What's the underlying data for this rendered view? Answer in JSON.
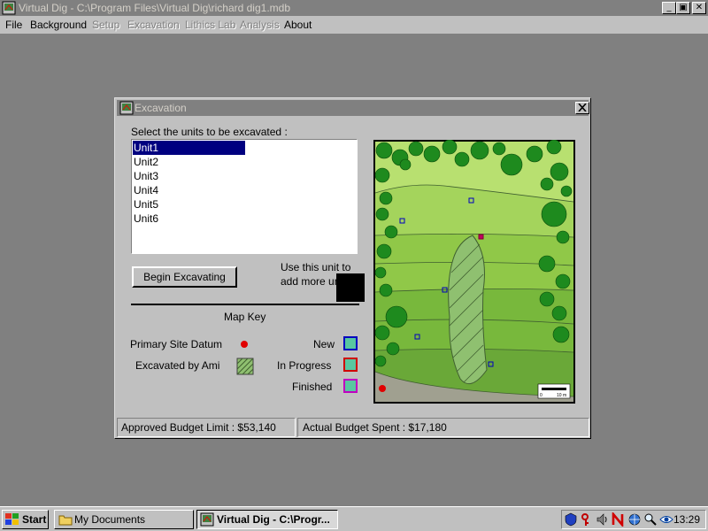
{
  "window": {
    "title": "Virtual Dig - C:\\Program Files\\Virtual Dig\\richard dig1.mdb",
    "minimize": "_",
    "maximize": "▣",
    "close": "✕"
  },
  "menu": [
    {
      "label": "File",
      "disabled": false
    },
    {
      "label": "Background",
      "disabled": false
    },
    {
      "label": "Setup",
      "disabled": true
    },
    {
      "label": "Excavation",
      "disabled": true
    },
    {
      "label": "Lithics Lab",
      "disabled": true
    },
    {
      "label": "Analysis",
      "disabled": true
    },
    {
      "label": "About",
      "disabled": false
    }
  ],
  "dialog": {
    "title": "Excavation",
    "prompt": "Select the units to be excavated :",
    "units": [
      "Unit1",
      "Unit2",
      "Unit3",
      "Unit4",
      "Unit5",
      "Unit6"
    ],
    "selected_unit": "Unit1",
    "begin_button": "Begin Excavating",
    "use_unit_text": "Use this unit to add more units.",
    "map_key_title": "Map Key",
    "key": {
      "datum": "Primary Site Datum",
      "excavated": "Excavated by Ami",
      "new": "New",
      "in_progress": "In Progress",
      "finished": "Finished"
    },
    "key_colors": {
      "datum": "#e00000",
      "new": "#0000c0",
      "in_progress": "#d00000",
      "finished": "#c000c0",
      "swatch_fill": "#58c7a0",
      "excavated_fill": "#8fc070"
    },
    "map_scale": [
      "0",
      "10 m"
    ],
    "budget_limit": "Approved Budget Limit : $53,140",
    "budget_spent": "Actual Budget Spent : $17,180"
  },
  "taskbar": {
    "start": "Start",
    "tasks": [
      {
        "label": "My Documents",
        "active": false
      },
      {
        "label": "Virtual Dig - C:\\Progr...",
        "active": true
      }
    ],
    "clock": "13:29"
  }
}
